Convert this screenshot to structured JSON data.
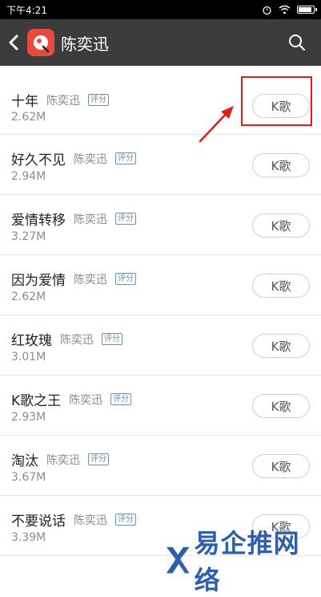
{
  "status_bar": {
    "time": "下午4:21",
    "battery_level": 0.9
  },
  "header": {
    "title": "陈奕迅",
    "back_icon": "chevron-left-icon",
    "search_icon": "search-icon"
  },
  "songs": [
    {
      "name": "十年",
      "singer": "陈奕迅",
      "badge": "评分",
      "size": "2.62M",
      "button": "K歌"
    },
    {
      "name": "好久不见",
      "singer": "陈奕迅",
      "badge": "评分",
      "size": "2.94M",
      "button": "K歌"
    },
    {
      "name": "爱情转移",
      "singer": "陈奕迅",
      "badge": "评分",
      "size": "3.27M",
      "button": "K歌"
    },
    {
      "name": "因为爱情",
      "singer": "陈奕迅",
      "badge": "评分",
      "size": "2.62M",
      "button": "K歌"
    },
    {
      "name": "红玫瑰",
      "singer": "陈奕迅",
      "badge": "评分",
      "size": "3.01M",
      "button": "K歌"
    },
    {
      "name": "K歌之王",
      "singer": "陈奕迅",
      "badge": "评分",
      "size": "2.93M",
      "button": "K歌"
    },
    {
      "name": "淘汰",
      "singer": "陈奕迅",
      "badge": "评分",
      "size": "3.67M",
      "button": "K歌"
    },
    {
      "name": "不要说话",
      "singer": "陈奕迅",
      "badge": "评分",
      "size": "3.39M",
      "button": "K歌"
    }
  ],
  "watermark": {
    "text": "易企推网络"
  },
  "colors": {
    "header_bg": "#3c3c3c",
    "accent_red": "#e31b1b",
    "badge_blue": "#6e8fb0",
    "watermark_blue": "#2e5fa8"
  }
}
